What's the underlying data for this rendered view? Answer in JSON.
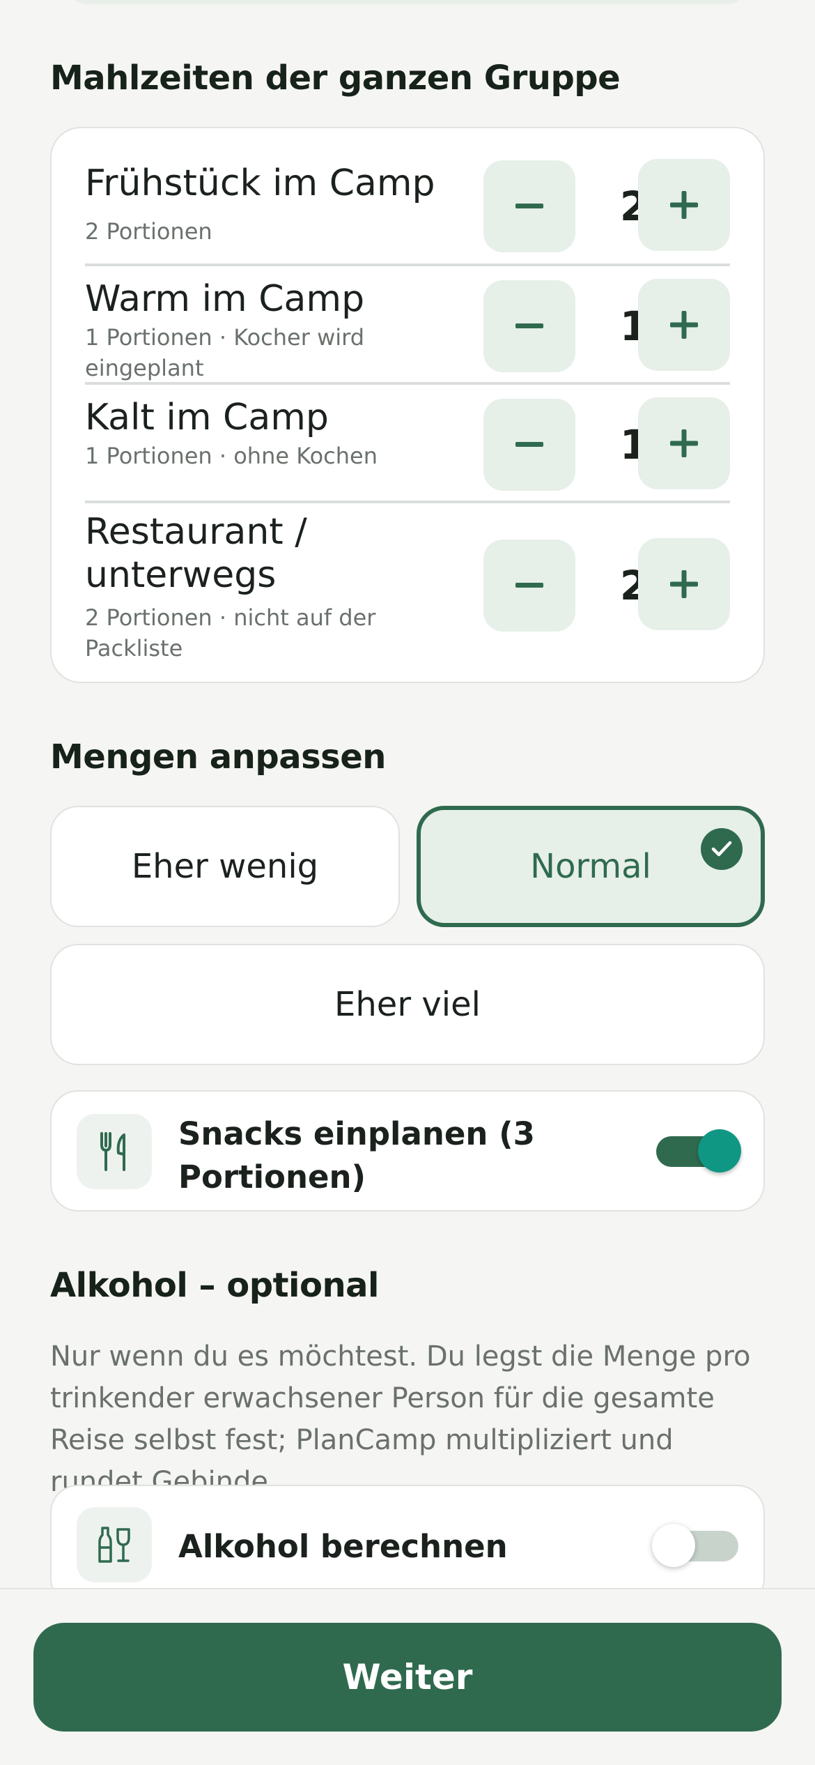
{
  "meals": {
    "title": "Mahlzeiten der ganzen Gruppe",
    "items": [
      {
        "name": "Frühstück im Camp",
        "sub": "2 Portionen",
        "count": "2"
      },
      {
        "name": "Warm im Camp",
        "sub": "1 Portionen · Kocher wird eingeplant",
        "count": "1"
      },
      {
        "name": "Kalt im Camp",
        "sub": "1 Portionen · ohne Kochen",
        "count": "1"
      },
      {
        "name": "Restaurant / unterwegs",
        "sub": "2 Portionen · nicht auf der Packliste",
        "count": "2"
      }
    ],
    "minus_symbol": "−",
    "plus_symbol": "+"
  },
  "amounts": {
    "title": "Mengen anpassen",
    "options": [
      "Eher wenig",
      "Normal",
      "Eher viel"
    ],
    "selected": "Normal"
  },
  "snacks": {
    "label": "Snacks einplanen (3 Portionen)",
    "icon": "cutlery-icon",
    "enabled": true
  },
  "alcohol": {
    "title": "Alkohol – optional",
    "description": "Nur wenn du es möchtest. Du legst die Menge pro trinkender erwachsener Person für die gesamte Reise selbst fest; PlanCamp multipliziert und rundet Gebinde.",
    "toggle_label": "Alkohol berechnen",
    "icon": "bottle-glass-icon",
    "enabled": false
  },
  "footer": {
    "next_label": "Weiter"
  },
  "colors": {
    "accent": "#2f6a4f",
    "accent_light": "#e6efe8",
    "switch_knob": "#0f9784"
  }
}
